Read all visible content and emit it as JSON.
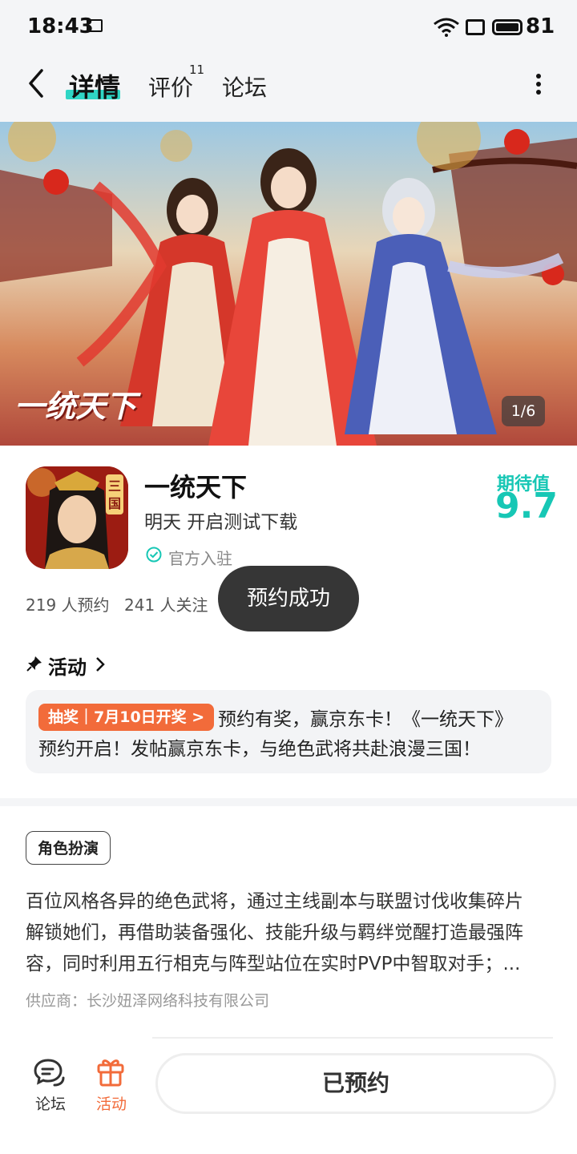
{
  "status_bar": {
    "time": "18:43",
    "battery": "81"
  },
  "nav": {
    "tabs": [
      {
        "label": "详情",
        "active": true
      },
      {
        "label": "评价",
        "count": "11"
      },
      {
        "label": "论坛"
      }
    ]
  },
  "banner": {
    "logo_text": "一统天下",
    "page_indicator": "1/6"
  },
  "app": {
    "name": "一统天下",
    "subtitle": "明天 开启测试下载",
    "verified": "官方入驻",
    "expect_label": "期待值",
    "expect_score": "9.7",
    "reserve_count": "219 人预约",
    "follow_count": "241 人关注"
  },
  "toast": "预约成功",
  "activity": {
    "title": "活动",
    "badge": "抽奖｜7月10日开奖 >",
    "line1": "预约有奖，赢京东卡！《一统天下》",
    "line2": "预约开启！发帖赢京东卡，与绝色武将共赴浪漫三国！"
  },
  "description": {
    "tag": "角色扮演",
    "lines": [
      "百位风格各异的绝色武将，通过主线副本与联盟讨伐收集碎片",
      "解锁她们，再借助装备强化、技能升级与羁绊觉醒打造最强阵",
      "容，同时利用五行相克与阵型站位在实时PVP中智取对手；..."
    ],
    "supplier": "供应商：长沙妞泽网络科技有限公司"
  },
  "bottom_bar": {
    "forum_label": "论坛",
    "activity_label": "活动",
    "reserved_button": "已预约"
  },
  "colors": {
    "accent_teal": "#17c7b5",
    "accent_orange": "#f26b3a"
  }
}
